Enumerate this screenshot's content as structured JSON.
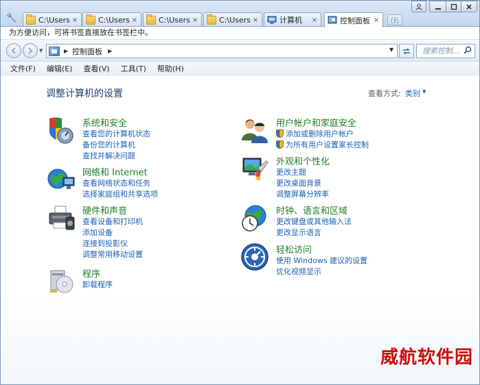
{
  "tabs": [
    {
      "label": "C:\\Users\\",
      "icon": "folder-icon",
      "active": false
    },
    {
      "label": "C:\\Users\\",
      "icon": "folder-icon",
      "active": false
    },
    {
      "label": "C:\\Users\\",
      "icon": "folder-icon",
      "active": false
    },
    {
      "label": "C:\\Users\\",
      "icon": "folder-icon",
      "active": false
    },
    {
      "label": "计算机",
      "icon": "computer-icon",
      "active": false
    },
    {
      "label": "控制面板",
      "icon": "control-panel-icon",
      "active": true
    }
  ],
  "tab_close_glyph": "×",
  "bookmark_bar": {
    "hint": "为方便访问，可将书签直接放在书签栏中。"
  },
  "address": {
    "crumb": "控制面板",
    "search_placeholder": "搜索控制..."
  },
  "menu": {
    "file": "文件(F)",
    "edit": "编辑(E)",
    "view": "查看(V)",
    "tools": "工具(T)",
    "help": "帮助(H)"
  },
  "page": {
    "title": "调整计算机的设置",
    "view_label": "查看方式:",
    "view_value": "类别"
  },
  "categories": {
    "system": {
      "title": "系统和安全",
      "links": [
        "查看您的计算机状态",
        "备份您的计算机",
        "查找并解决问题"
      ]
    },
    "network": {
      "title": "网络和 Internet",
      "links": [
        "查看网络状态和任务",
        "选择家庭组和共享选项"
      ]
    },
    "hardware": {
      "title": "硬件和声音",
      "links": [
        "查看设备和打印机",
        "添加设备",
        "连接到投影仪",
        "调整常用移动设置"
      ]
    },
    "programs": {
      "title": "程序",
      "links": [
        "卸载程序"
      ]
    },
    "users": {
      "title": "用户帐户和家庭安全",
      "links": [
        "添加或删除用户帐户",
        "为所有用户设置家长控制"
      ]
    },
    "appearance": {
      "title": "外观和个性化",
      "links": [
        "更改主题",
        "更改桌面背景",
        "调整屏幕分辨率"
      ]
    },
    "clock": {
      "title": "时钟、语言和区域",
      "links": [
        "更改键盘或其他输入法",
        "更改显示语言"
      ]
    },
    "ease": {
      "title": "轻松访问",
      "links": [
        "使用 Windows 建议的设置",
        "优化视频显示"
      ]
    }
  },
  "watermark": "威航软件园",
  "colors": {
    "link": "#1a5fb4",
    "category_title": "#1e7d27",
    "page_title": "#1e3e6e",
    "watermark": "#d20b0b"
  }
}
